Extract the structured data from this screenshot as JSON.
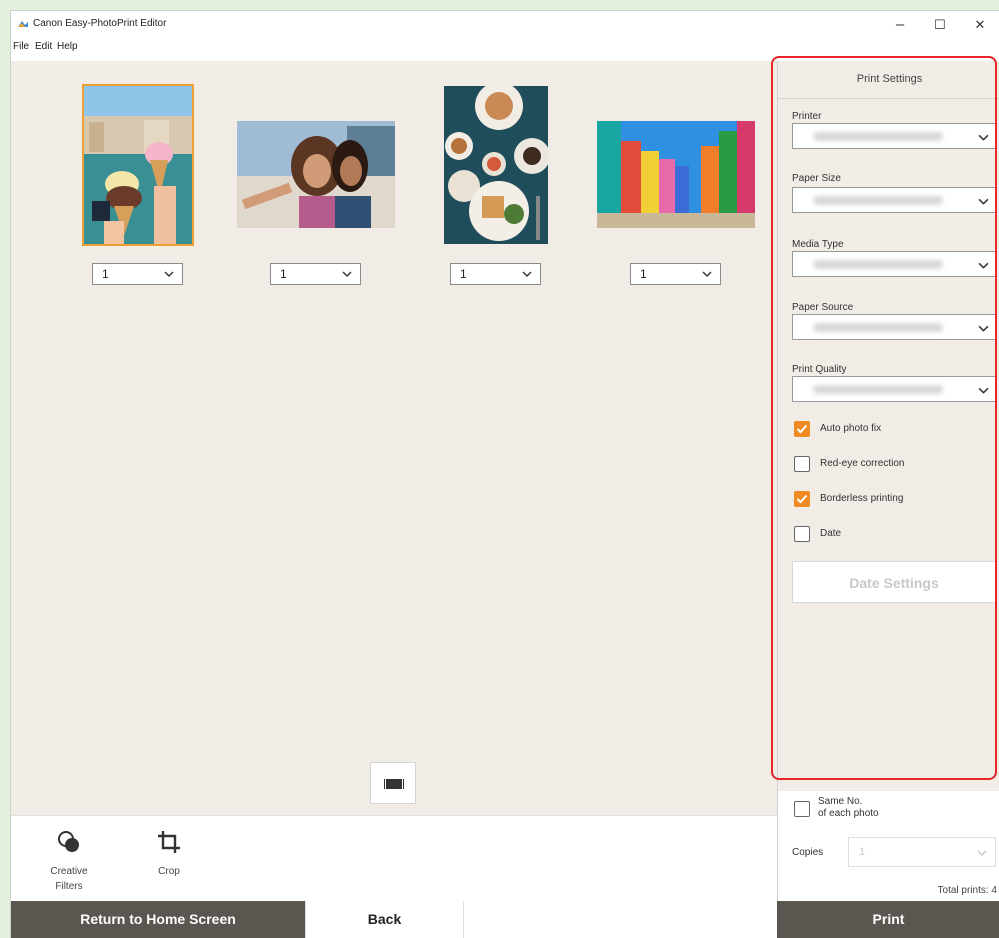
{
  "window": {
    "title": "Canon Easy-PhotoPrint Editor",
    "minimize": "–",
    "maximize": "☐",
    "close": "✕"
  },
  "menu": [
    "File",
    "Edit",
    "Help"
  ],
  "photos": [
    {
      "name": "Gelato in Venice",
      "quantity": "1",
      "selected": true
    },
    {
      "name": "Selfie",
      "quantity": "1",
      "selected": false
    },
    {
      "name": "Food table",
      "quantity": "1",
      "selected": false
    },
    {
      "name": "Colorful houses",
      "quantity": "1",
      "selected": false
    }
  ],
  "tools": {
    "creative_filters": [
      "Creative",
      "Filters"
    ],
    "crop": "Crop"
  },
  "buttons": {
    "return_home": "Return to Home Screen",
    "back": "Back",
    "print": "Print"
  },
  "print_settings": {
    "title": "Print Settings",
    "fields": [
      "Printer",
      "Paper Size",
      "Media Type",
      "Paper Source",
      "Print Quality"
    ],
    "checkboxes": [
      {
        "label": "Auto photo fix",
        "checked": true
      },
      {
        "label": "Red-eye correction",
        "checked": false
      },
      {
        "label": "Borderless printing",
        "checked": true
      },
      {
        "label": "Date",
        "checked": false
      }
    ],
    "date_settings": "Date Settings"
  },
  "copies": {
    "same_no_line1": "Same No.",
    "same_no_line2": "of each photo",
    "same_no_checked": false,
    "label": "Copies",
    "value": "1",
    "total": "Total prints: 4"
  },
  "colors": {
    "accent_orange": "#f08a22",
    "dark_button": "#5b564f",
    "highlight_red": "#e8262a",
    "canvas_bg": "#f1ede6"
  }
}
